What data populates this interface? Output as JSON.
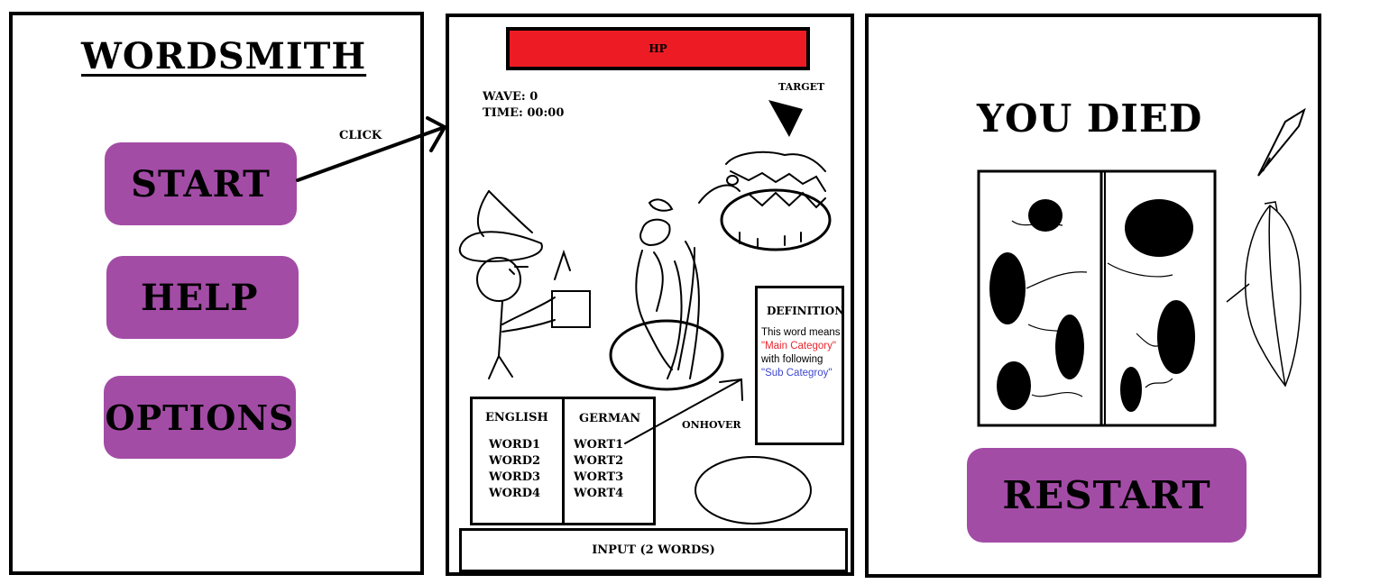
{
  "menu": {
    "title": "WORDSMITH",
    "buttons": [
      "START",
      "HELP",
      "OPTIONS"
    ],
    "click_label": "CLICK"
  },
  "game": {
    "hp_label": "HP",
    "wave": "WAVE: 0",
    "time": "TIME: 00:00",
    "target_label": "TARGET",
    "vocab": {
      "english_header": "ENGLISH",
      "german_header": "GERMAN",
      "english_words": [
        "WORD1",
        "WORD2",
        "WORD3",
        "WORD4"
      ],
      "german_words": [
        "WORT1",
        "WORT2",
        "WORT3",
        "WORT4"
      ]
    },
    "onhover_label": "ONHOVER",
    "definition": {
      "title": "DEFINITION",
      "text_prefix": "This word means ",
      "main_category": "\"Main Category\"",
      "text_middle": " with following ",
      "sub_category": "\"Sub Categroy\""
    },
    "input_label": "INPUT (2 WORDS)"
  },
  "death": {
    "title": "YOU DIED",
    "restart_label": "RESTART"
  },
  "colors": {
    "button_purple": "#a34ca6",
    "hp_red": "#ed1c24",
    "main_category_red": "#e8272e",
    "sub_category_blue": "#3f48cc"
  }
}
